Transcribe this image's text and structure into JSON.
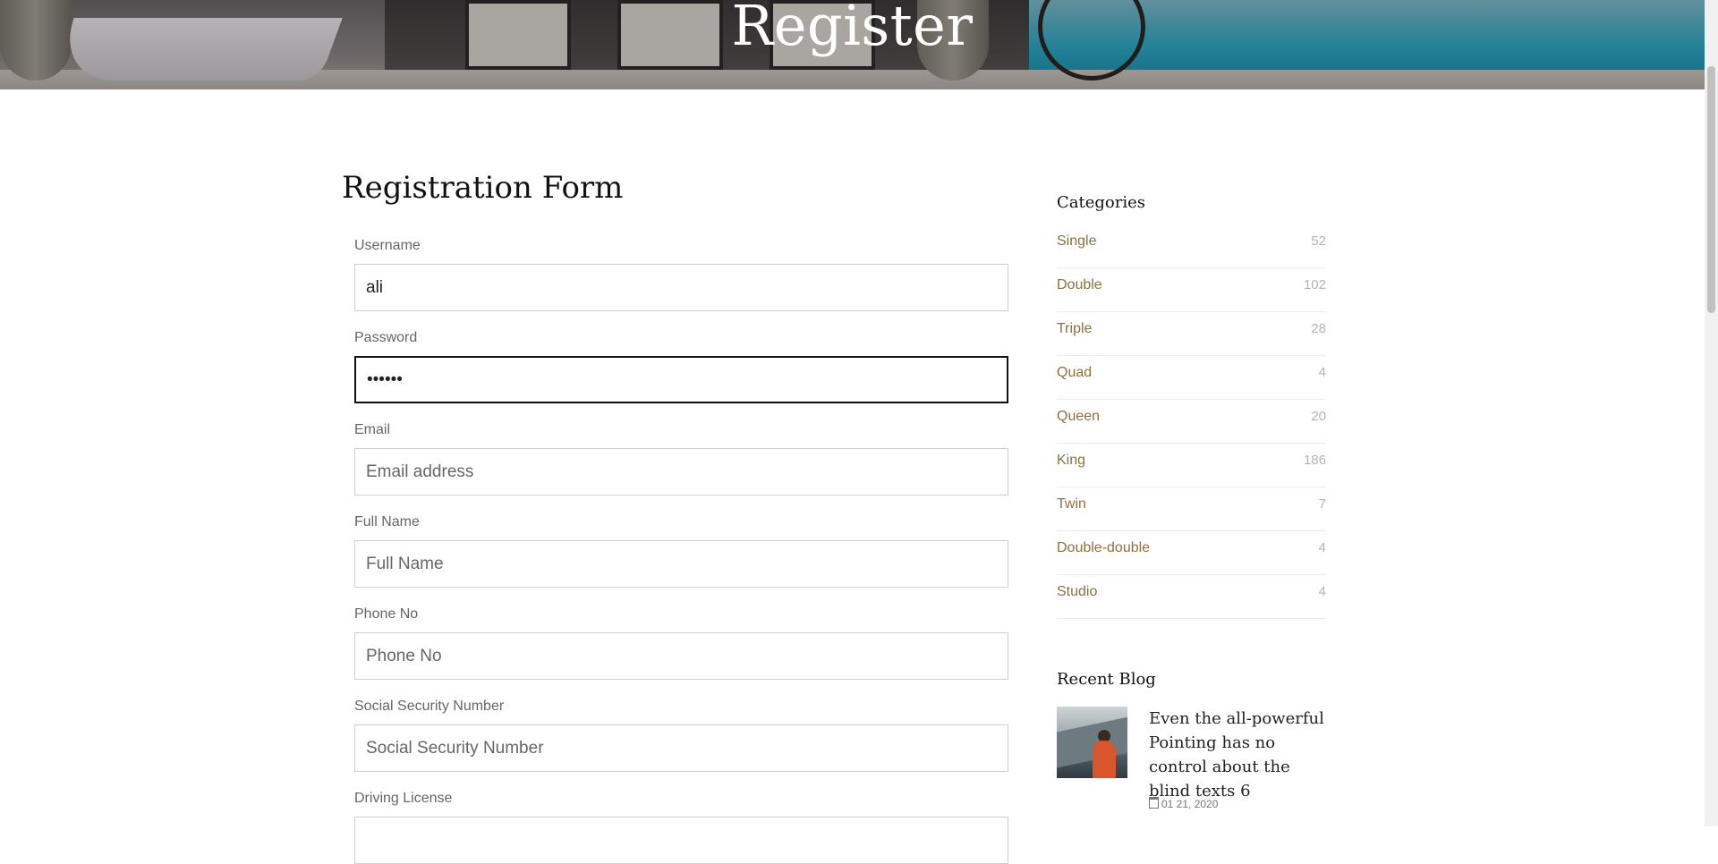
{
  "hero": {
    "title": "Register"
  },
  "form": {
    "title": "Registration Form",
    "fields": [
      {
        "label": "Username",
        "value": "ali",
        "placeholder": ""
      },
      {
        "label": "Password",
        "value": "••••••",
        "placeholder": ""
      },
      {
        "label": "Email",
        "value": "",
        "placeholder": "Email address"
      },
      {
        "label": "Full Name",
        "value": "",
        "placeholder": "Full Name"
      },
      {
        "label": "Phone No",
        "value": "",
        "placeholder": "Phone No"
      },
      {
        "label": "Social Security Number",
        "value": "",
        "placeholder": "Social Security Number"
      },
      {
        "label": "Driving License",
        "value": "",
        "placeholder": ""
      }
    ]
  },
  "sidebar": {
    "categories_heading": "Categories",
    "categories": [
      {
        "name": "Single",
        "count": "52"
      },
      {
        "name": "Double",
        "count": "102"
      },
      {
        "name": "Triple",
        "count": "28"
      },
      {
        "name": "Quad",
        "count": "4"
      },
      {
        "name": "Queen",
        "count": "20"
      },
      {
        "name": "King",
        "count": "186"
      },
      {
        "name": "Twin",
        "count": "7"
      },
      {
        "name": "Double-double",
        "count": "4"
      },
      {
        "name": "Studio",
        "count": "4"
      }
    ],
    "recent_blog_heading": "Recent Blog",
    "recent_blog": {
      "title": "Even the all-powerful Pointing has no control about the blind texts 6",
      "date": "01 21, 2020"
    }
  },
  "colors": {
    "accent": "#8f6f3f",
    "count_text": "#b3b3b3",
    "border": "#cfcfcf",
    "focus_border": "#111111"
  },
  "icons": [
    "calendar-icon"
  ]
}
